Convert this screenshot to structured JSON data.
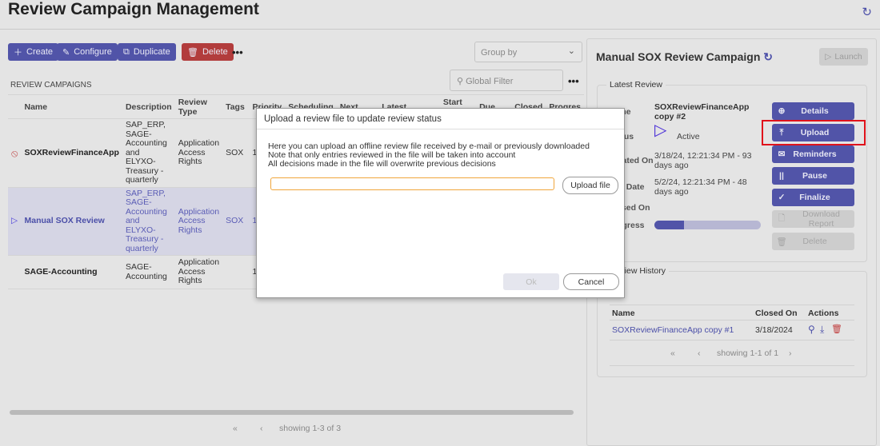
{
  "header": {
    "title": "Review Campaign Management",
    "refresh_icon": "refresh-icon"
  },
  "toolbar": {
    "create": "Create",
    "configure": "Configure",
    "duplicate": "Duplicate",
    "delete": "Delete",
    "more": "•••",
    "group_by_placeholder": "Group by"
  },
  "campaigns": {
    "section_title": "REVIEW CAMPAIGNS",
    "filter_placeholder": "Global Filter",
    "more": "•••",
    "columns": [
      "Name",
      "Description",
      "Review Type",
      "Tags",
      "Priority",
      "Scheduling",
      "Next",
      "Latest",
      "Start On",
      "Due",
      "Closed",
      "Progres"
    ],
    "rows": [
      {
        "status_icon": "disabled-icon",
        "name": "SOXReviewFinanceApp",
        "description": "SAP_ERP, SAGE-Accounting and ELYXO-Treasury - quarterly",
        "type": "Application Access Rights",
        "tags": "SOX",
        "priority": "1"
      },
      {
        "status_icon": "play-icon",
        "name": "Manual SOX Review",
        "description": "SAP_ERP, SAGE-Accounting and ELYXO-Treasury - quarterly",
        "type": "Application Access Rights",
        "tags": "SOX",
        "priority": "1",
        "selected": true
      },
      {
        "status_icon": "",
        "name": "SAGE-Accounting",
        "description": "SAGE-Accounting",
        "type": "Application Access Rights",
        "tags": "",
        "priority": "1"
      }
    ],
    "pager": {
      "first": "«",
      "prev": "‹",
      "text": "showing 1-3 of 3"
    }
  },
  "detail": {
    "title": "Manual SOX Review Campaign",
    "launch": "Launch",
    "latest_review": {
      "legend": "Latest Review",
      "labels": {
        "name": "Name",
        "status": "Status",
        "created": "Created On",
        "due": "Due Date",
        "closed": "Closed On",
        "progress": "Progress"
      },
      "name": "SOXReviewFinanceApp copy #2",
      "status": "Active",
      "created": "3/18/24, 12:21:34 PM - 93 days ago",
      "due": "5/2/24, 12:21:34 PM - 48 days ago",
      "closed": "",
      "progress": 0.28,
      "buttons": {
        "details": "Details",
        "upload": "Upload",
        "reminders": "Reminders",
        "pause": "Pause",
        "finalize": "Finalize",
        "download": "Download Report",
        "delete": "Delete"
      }
    },
    "history": {
      "legend": "Review History",
      "columns": [
        "Name",
        "Closed On",
        "Actions"
      ],
      "rows": [
        {
          "name": "SOXReviewFinanceApp copy #1",
          "closed": "3/18/2024"
        }
      ],
      "pager": {
        "first": "«",
        "prev": "‹",
        "text": "showing 1-1 of 1",
        "next": "›"
      }
    }
  },
  "modal": {
    "title": "Upload a review file to update review status",
    "lines": [
      "Here you can upload an offline review file received by e-mail or previously downloaded",
      "Note that only entries reviewed in the file will be taken into account",
      "All decisions made in the file will overwrite previous decisions"
    ],
    "file_value": "",
    "upload_file": "Upload file",
    "ok": "Ok",
    "cancel": "Cancel"
  },
  "colors": {
    "accent": "#5154a8",
    "danger": "#b23c3c",
    "highlight": "#e0121b"
  }
}
